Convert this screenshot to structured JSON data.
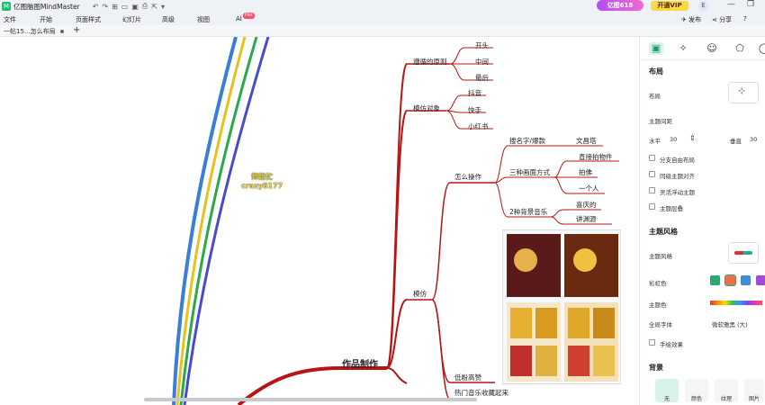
{
  "titlebar": {
    "app_name": "亿图脑图MindMaster",
    "badge_618": "亿图618",
    "vip_label": "开通VIP",
    "avatar": "E"
  },
  "menu": {
    "items": [
      "文件",
      "开始",
      "页面样式",
      "幻灯片",
      "高级",
      "视图",
      "AI"
    ],
    "ai_badge": "Hot",
    "publish": "发布",
    "share": "分享",
    "help": "?"
  },
  "tab": {
    "doc_title": "一帖15...怎么布局",
    "add": "+"
  },
  "mindmap": {
    "root": "作品制作",
    "branch_avoid": "遵循的原则",
    "avoid_children": [
      "开头",
      "中间",
      "最后"
    ],
    "branch_imitate_obj": "模仿对象",
    "imitate_children": [
      "抖音",
      "快手",
      "小红书"
    ],
    "branch_imitate": "模仿",
    "branch_how": "怎么操作",
    "how_children": [
      "搜名字/爆款",
      "三种画面方式",
      "2种背景音乐"
    ],
    "search_child": "文昌塔",
    "view_children": [
      "直接拍物件",
      "拍佛",
      "一个人"
    ],
    "music_children": [
      "喜庆的",
      "讲渊源"
    ],
    "branch_low_fans": "低粉高赞",
    "branch_hot_music": "热门音乐收藏起来",
    "watermark_line1": "师姐忙",
    "watermark_line2": "crazy8177"
  },
  "panel": {
    "section_layout": "布局",
    "layout_label": "布局",
    "spacing_label": "主题间距",
    "horizontal_label": "水平",
    "horizontal_value": "30",
    "vertical_label": "垂直",
    "vertical_value": "30",
    "checks": [
      "分支自由布局",
      "同级主题对齐",
      "灵活浮动主题",
      "主题层叠"
    ],
    "section_style": "主题风格",
    "style_label": "主题风格",
    "rainbow_label": "彩虹色",
    "theme_color_label": "主题色",
    "font_label": "全局字体",
    "font_value": "微软雅黑 (大)",
    "hand_label": "手绘效果",
    "section_bg": "背景",
    "bg_options": [
      "无",
      "颜色",
      "纹理",
      "图片"
    ]
  },
  "colors": {
    "branch_red": "#b81414",
    "accent_green": "#1a9a6a",
    "line_blue": "#3a7fd5",
    "line_yellow": "#e6c21a",
    "line_green": "#2aa84a",
    "line_indigo": "#4a4ad0"
  }
}
